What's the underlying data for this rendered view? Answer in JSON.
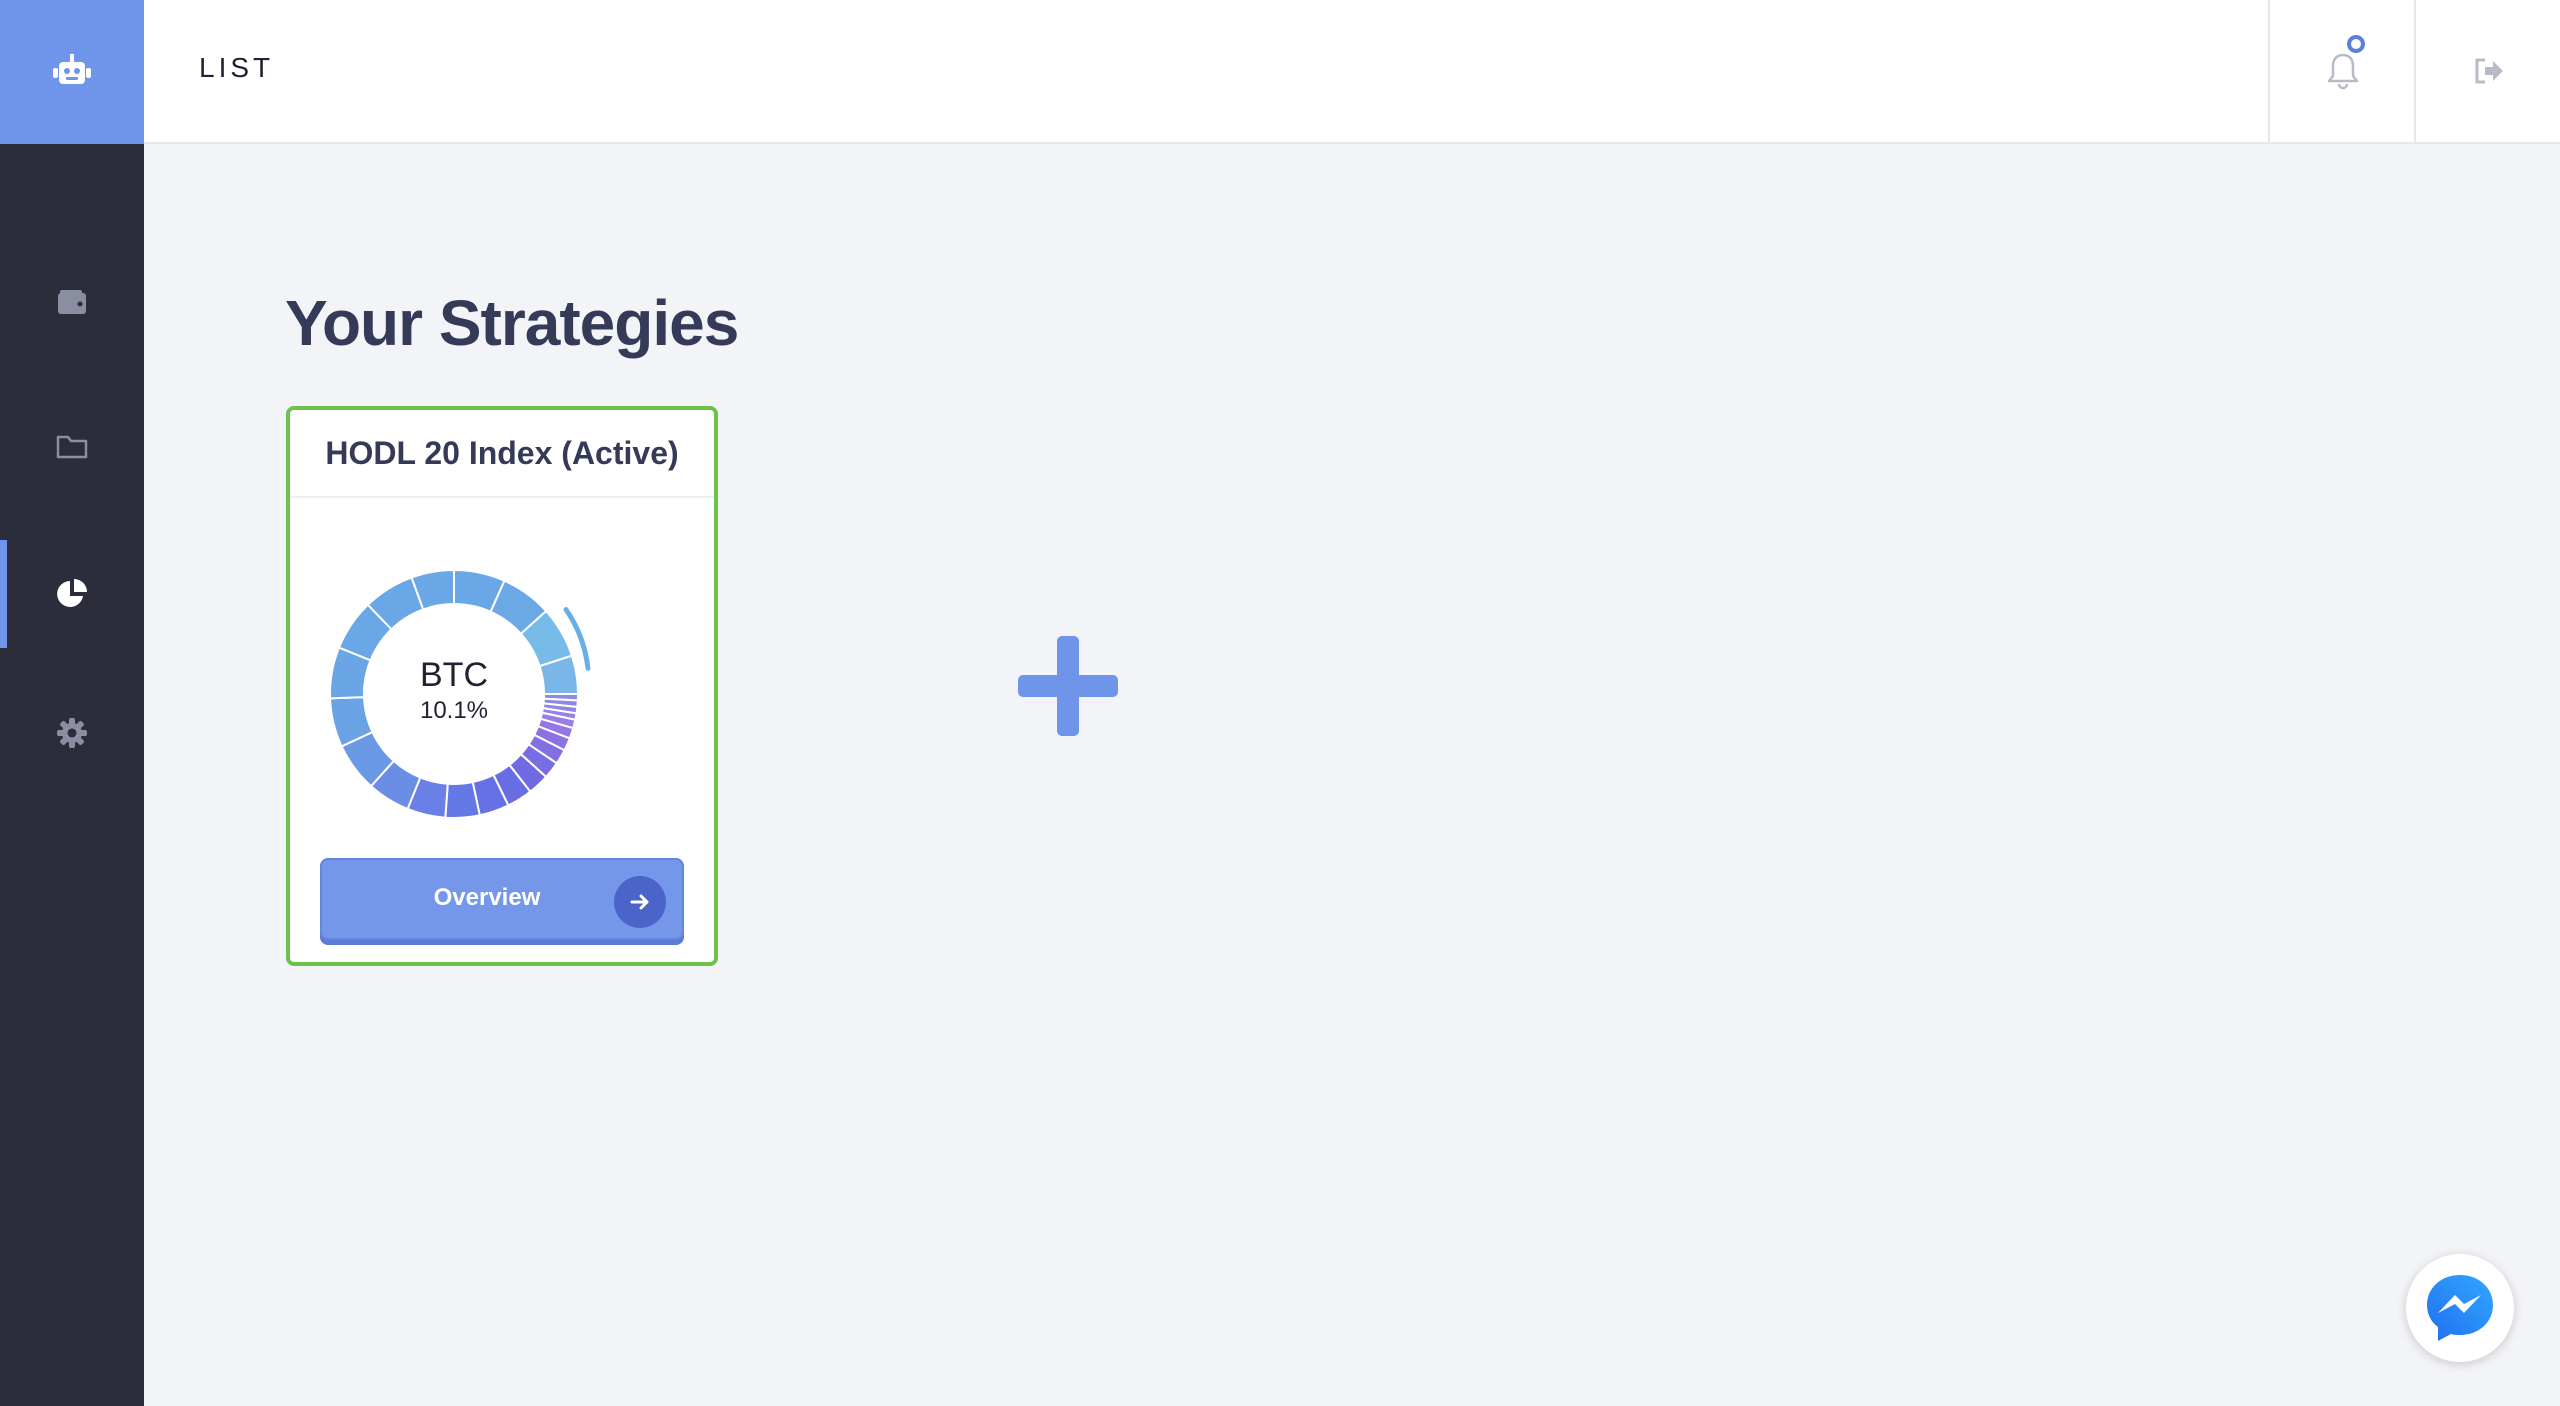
{
  "header": {
    "title": "LIST",
    "notifications_label": "Notifications",
    "logout_label": "Log out"
  },
  "sidebar": {
    "logo_icon": "robot-icon",
    "items": [
      {
        "icon": "wallet-icon",
        "active": false
      },
      {
        "icon": "folder-icon",
        "active": false
      },
      {
        "icon": "pie-chart-icon",
        "active": true
      },
      {
        "icon": "gear-icon",
        "active": false
      }
    ]
  },
  "main": {
    "title": "Your Strategies",
    "strategies": [
      {
        "name": "HODL 20 Index (Active)",
        "center_symbol": "BTC",
        "center_percent": "10.1%",
        "button_label": "Overview",
        "status_color": "#6cc24a"
      }
    ],
    "add_icon": "plus-icon"
  },
  "colors": {
    "accent": "#6f95ea",
    "sidebar_bg": "#2b2d3a",
    "active_border": "#6cc24a"
  },
  "chat_widget": {
    "icon": "messenger-icon"
  }
}
